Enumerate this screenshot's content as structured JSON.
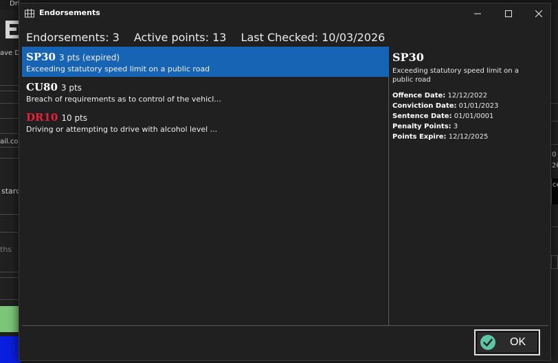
{
  "background": {
    "title_fragment": "Dri",
    "save_fragment": "ave D",
    "email_fragment": "ail.com",
    "stard_fragment": "stard",
    "ths_fragment": "ths",
    "right_fragment_1": "0",
    "right_fragment_2": "26",
    "right_fragment_3": "ce"
  },
  "dialog": {
    "title": "Endorsements",
    "icon": "window-grid-icon",
    "controls": {
      "minimize": "minimize-icon",
      "maximize": "maximize-icon",
      "close": "close-icon"
    }
  },
  "summary": {
    "endorsements": "Endorsements: 3",
    "active_points": "Active points: 13",
    "last_checked": "Last Checked: 10/03/2026"
  },
  "endorsements": [
    {
      "code": "SP30",
      "points": "3 pts (expired)",
      "description": "Exceeding statutory speed limit on a public road",
      "selected": true,
      "color": "#ffffff"
    },
    {
      "code": "CU80",
      "points": "3 pts",
      "description": "Breach of requirements as to control of the vehicl...",
      "selected": false,
      "color": "#ffffff"
    },
    {
      "code": "DR10",
      "points": "10 pts",
      "description": "Driving or attempting to drive with alcohol level ...",
      "selected": false,
      "color": "#e8203a"
    }
  ],
  "details": {
    "code": "SP30",
    "description": "Exceeding statutory speed limit on a public road",
    "offence_date_label": "Offence Date:",
    "offence_date": " 12/12/2022",
    "conviction_date_label": "Conviction Date:",
    "conviction_date": " 01/01/2023",
    "sentence_date_label": "Sentence Date:",
    "sentence_date": " 01/01/0001",
    "penalty_points_label": "Penalty Points:",
    "penalty_points": " 3",
    "points_expire_label": "Points Expire:",
    "points_expire": " 12/12/2025"
  },
  "footer": {
    "ok_label": "OK",
    "ok_icon": "checkmark-circle-icon"
  },
  "colors": {
    "selection": "#1764b4",
    "alert_code": "#e8203a",
    "ok_icon": "#5ec4a4"
  }
}
